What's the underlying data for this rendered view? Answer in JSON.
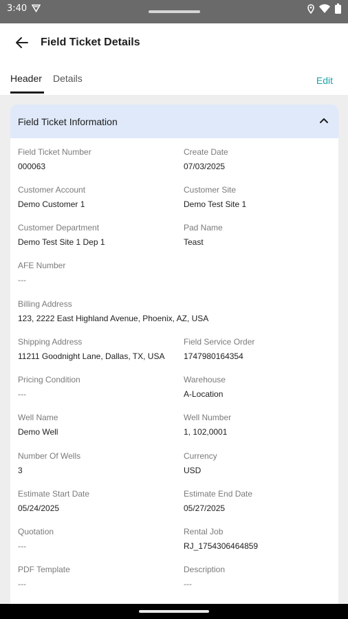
{
  "status_bar": {
    "time": "3:40"
  },
  "app_bar": {
    "title": "Field Ticket Details"
  },
  "tabs": {
    "header": "Header",
    "details": "Details",
    "edit": "Edit"
  },
  "card": {
    "title": "Field Ticket Information",
    "fields": [
      {
        "label": "Field Ticket Number",
        "value": "000063"
      },
      {
        "label": "Create Date",
        "value": "07/03/2025"
      },
      {
        "label": "Customer Account",
        "value": "Demo Customer 1"
      },
      {
        "label": "Customer Site",
        "value": "Demo Test Site 1"
      },
      {
        "label": "Customer Department",
        "value": "Demo Test Site 1 Dep 1"
      },
      {
        "label": "Pad Name",
        "value": "Teast"
      },
      {
        "label": "AFE Number",
        "value": "---"
      },
      {
        "label": "Billing Address",
        "value": "123, 2222 East Highland Avenue, Phoenix, AZ, USA"
      },
      {
        "label": "Shipping Address",
        "value": "11211 Goodnight Lane, Dallas, TX, USA"
      },
      {
        "label": "Field Service Order",
        "value": "1747980164354"
      },
      {
        "label": "Pricing Condition",
        "value": "---"
      },
      {
        "label": "Warehouse",
        "value": "A-Location"
      },
      {
        "label": "Well Name",
        "value": "Demo Well"
      },
      {
        "label": "Well Number",
        "value": "1, 102,0001"
      },
      {
        "label": "Number Of Wells",
        "value": "3"
      },
      {
        "label": "Currency",
        "value": "USD"
      },
      {
        "label": "Estimate Start Date",
        "value": "05/24/2025"
      },
      {
        "label": "Estimate End Date",
        "value": "05/27/2025"
      },
      {
        "label": "Quotation",
        "value": "---"
      },
      {
        "label": "Rental Job",
        "value": "RJ_1754306464859"
      },
      {
        "label": "PDF Template",
        "value": "---"
      },
      {
        "label": "Description",
        "value": "---"
      }
    ]
  }
}
